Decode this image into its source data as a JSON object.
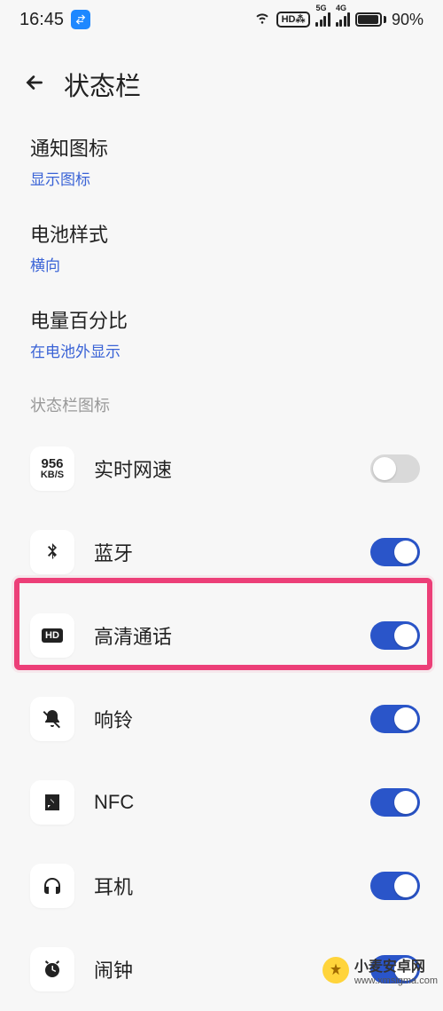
{
  "status_bar": {
    "time": "16:45",
    "hd_badge": "HD⁂",
    "sig1_label": "5G",
    "sig2_label": "4G",
    "battery_pct": "90%"
  },
  "header": {
    "title": "状态栏"
  },
  "links": {
    "notif_icon": {
      "label": "通知图标",
      "value": "显示图标"
    },
    "battery_style": {
      "label": "电池样式",
      "value": "横向"
    },
    "battery_pct": {
      "label": "电量百分比",
      "value": "在电池外显示"
    }
  },
  "section_title": "状态栏图标",
  "items": {
    "netspeed": {
      "label": "实时网速",
      "icon_num": "956",
      "icon_unit": "KB/S",
      "on": false
    },
    "bluetooth": {
      "label": "蓝牙",
      "on": true
    },
    "hd_call": {
      "label": "高清通话",
      "icon_text": "HD",
      "on": true
    },
    "ring": {
      "label": "响铃",
      "on": true
    },
    "nfc": {
      "label": "NFC",
      "on": true
    },
    "headphone": {
      "label": "耳机",
      "on": true
    },
    "alarm": {
      "label": "闹钟",
      "on": true
    }
  },
  "watermark": {
    "name": "小麦安卓网",
    "url": "www.xmsigma.com"
  }
}
